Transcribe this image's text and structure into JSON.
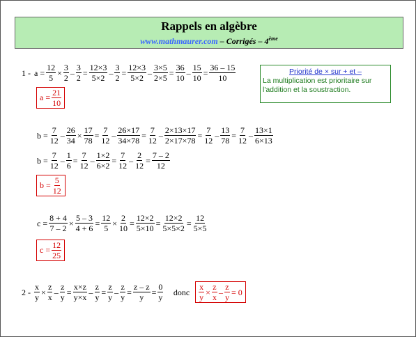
{
  "header": {
    "title": "Rappels en algèbre",
    "site": "www.mathmaurer.com",
    "rest": " – Corrigés – 4",
    "sup": "ème"
  },
  "note": {
    "title": "Priorité de × sur + et –",
    "body": "La multiplication  est prioritaire sur l'addition  et la soustraction."
  },
  "ex1": {
    "label": "1 -",
    "a": {
      "line": [
        "a =",
        {
          "n": "12",
          "d": "5"
        },
        "×",
        {
          "n": "3",
          "d": "2"
        },
        "–",
        {
          "n": "3",
          "d": "2"
        },
        "=",
        {
          "n": "12×3",
          "d": "5×2"
        },
        "–",
        {
          "n": "3",
          "d": "2"
        },
        "=",
        {
          "n": "12×3",
          "d": "5×2"
        },
        "–",
        {
          "n": "3×5",
          "d": "2×5"
        },
        "=",
        {
          "n": "36",
          "d": "10"
        },
        "–",
        {
          "n": "15",
          "d": "10"
        },
        "=",
        {
          "n": "36 – 15",
          "d": "10"
        }
      ],
      "answer": {
        "prefix": "a =",
        "n": "21",
        "d": "10"
      }
    },
    "b": {
      "line1": [
        "b =",
        {
          "n": "7",
          "d": "12"
        },
        "–",
        {
          "n": "26",
          "d": "34"
        },
        "×",
        {
          "n": "17",
          "d": "78"
        },
        "=",
        {
          "n": "7",
          "d": "12"
        },
        "–",
        {
          "n": "26×17",
          "d": "34×78"
        },
        "=",
        {
          "n": "7",
          "d": "12"
        },
        "–",
        {
          "n": "2×13×17",
          "d": "2×17×78"
        },
        "=",
        {
          "n": "7",
          "d": "12"
        },
        "–",
        {
          "n": "13",
          "d": "78"
        },
        "=",
        {
          "n": "7",
          "d": "12"
        },
        "–",
        {
          "n": "13×1",
          "d": "6×13"
        }
      ],
      "line2": [
        "b =",
        {
          "n": "7",
          "d": "12"
        },
        "–",
        {
          "n": "1",
          "d": "6"
        },
        "=",
        {
          "n": "7",
          "d": "12"
        },
        "–",
        {
          "n": "1×2",
          "d": "6×2"
        },
        "=",
        {
          "n": "7",
          "d": "12"
        },
        "–",
        {
          "n": "2",
          "d": "12"
        },
        "=",
        {
          "n": "7 – 2",
          "d": "12"
        }
      ],
      "answer": {
        "prefix": "b =",
        "n": "5",
        "d": "12"
      }
    },
    "c": {
      "line": [
        "c =",
        {
          "n": "8 + 4",
          "d": "7 – 2"
        },
        "×",
        {
          "n": "5 – 3",
          "d": "4 + 6"
        },
        "=",
        {
          "n": "12",
          "d": "5"
        },
        "×",
        {
          "n": "2",
          "d": "10"
        },
        "=",
        {
          "n": "12×2",
          "d": "5×10"
        },
        "=",
        {
          "n": "12×2",
          "d": "5×5×2"
        },
        "=",
        {
          "n": "12",
          "d": "5×5"
        }
      ],
      "answer": {
        "prefix": "c =",
        "n": "12",
        "d": "25"
      }
    }
  },
  "ex2": {
    "label": "2 -",
    "line": [
      {
        "n": "x",
        "d": "y"
      },
      "×",
      {
        "n": "z",
        "d": "x"
      },
      "–",
      {
        "n": "z",
        "d": "y"
      },
      "=",
      {
        "n": "x×z",
        "d": "y×x"
      },
      "–",
      {
        "n": "z",
        "d": "y"
      },
      "=",
      {
        "n": "z",
        "d": "y"
      },
      "–",
      {
        "n": "z",
        "d": "y"
      },
      "=",
      {
        "n": "z – z",
        "d": "y"
      },
      "=",
      {
        "n": "0",
        "d": "y"
      }
    ],
    "donc": "donc",
    "answer": [
      {
        "n": "x",
        "d": "y"
      },
      "×",
      {
        "n": "z",
        "d": "x"
      },
      "–",
      {
        "n": "z",
        "d": "y"
      },
      "= 0"
    ]
  }
}
